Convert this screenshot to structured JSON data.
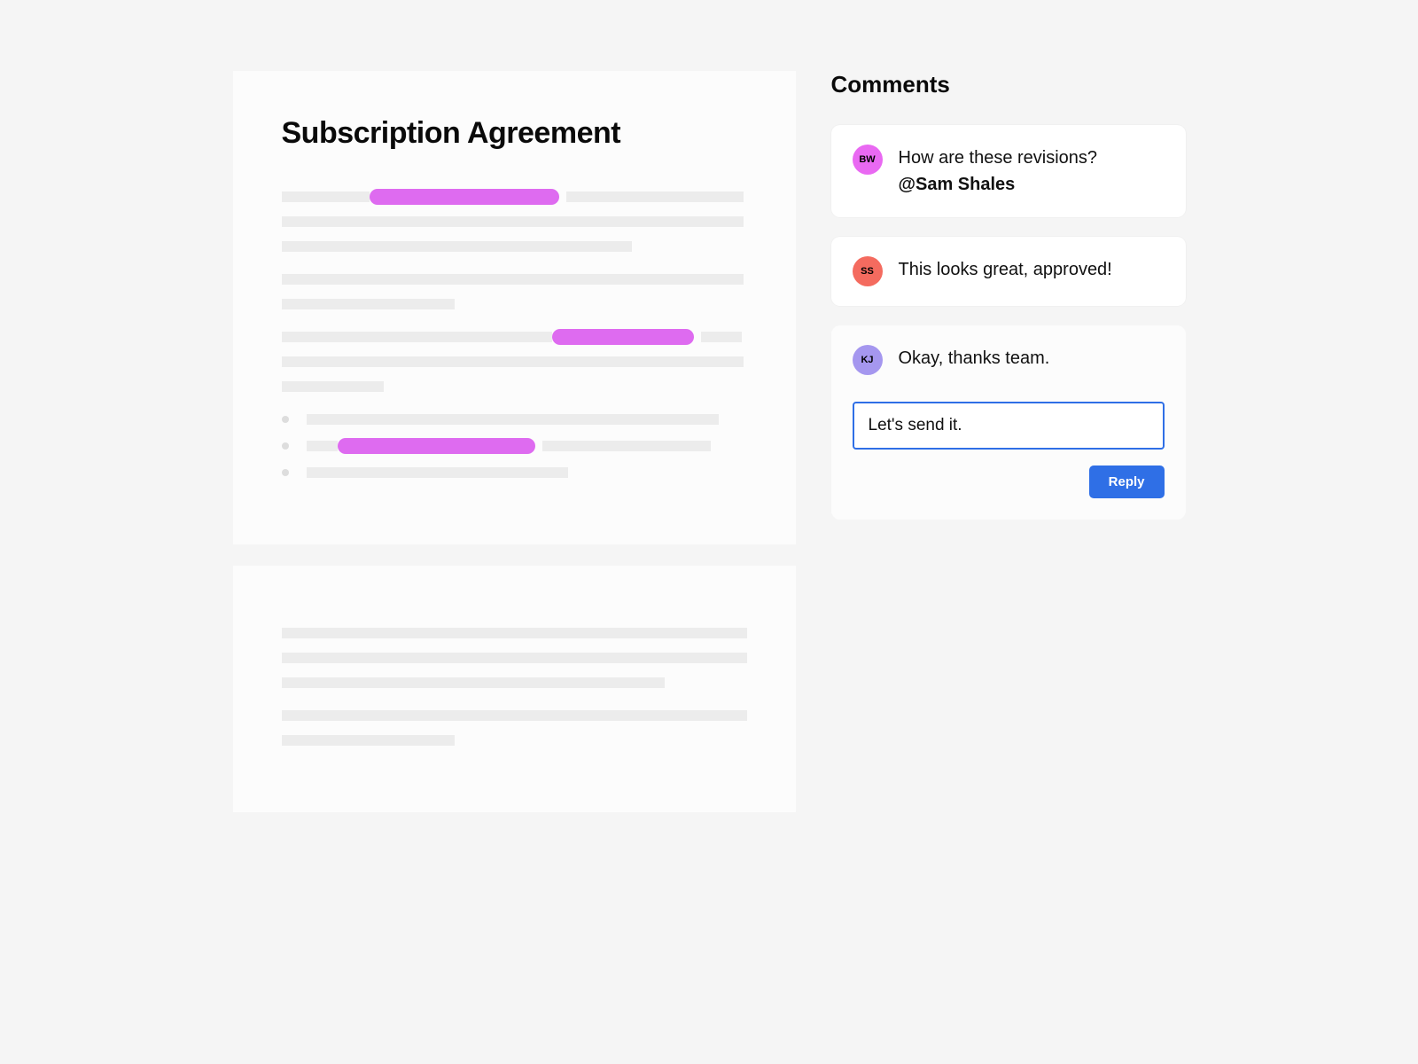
{
  "document": {
    "title": "Subscription Agreement"
  },
  "comments": {
    "title": "Comments",
    "items": [
      {
        "initials": "BW",
        "text": "How are these revisions?",
        "mention": "@Sam Shales"
      },
      {
        "initials": "SS",
        "text": "This looks great, approved!"
      },
      {
        "initials": "KJ",
        "text": "Okay, thanks team."
      }
    ],
    "reply_input_value": "Let's send it.",
    "reply_button_label": "Reply"
  }
}
